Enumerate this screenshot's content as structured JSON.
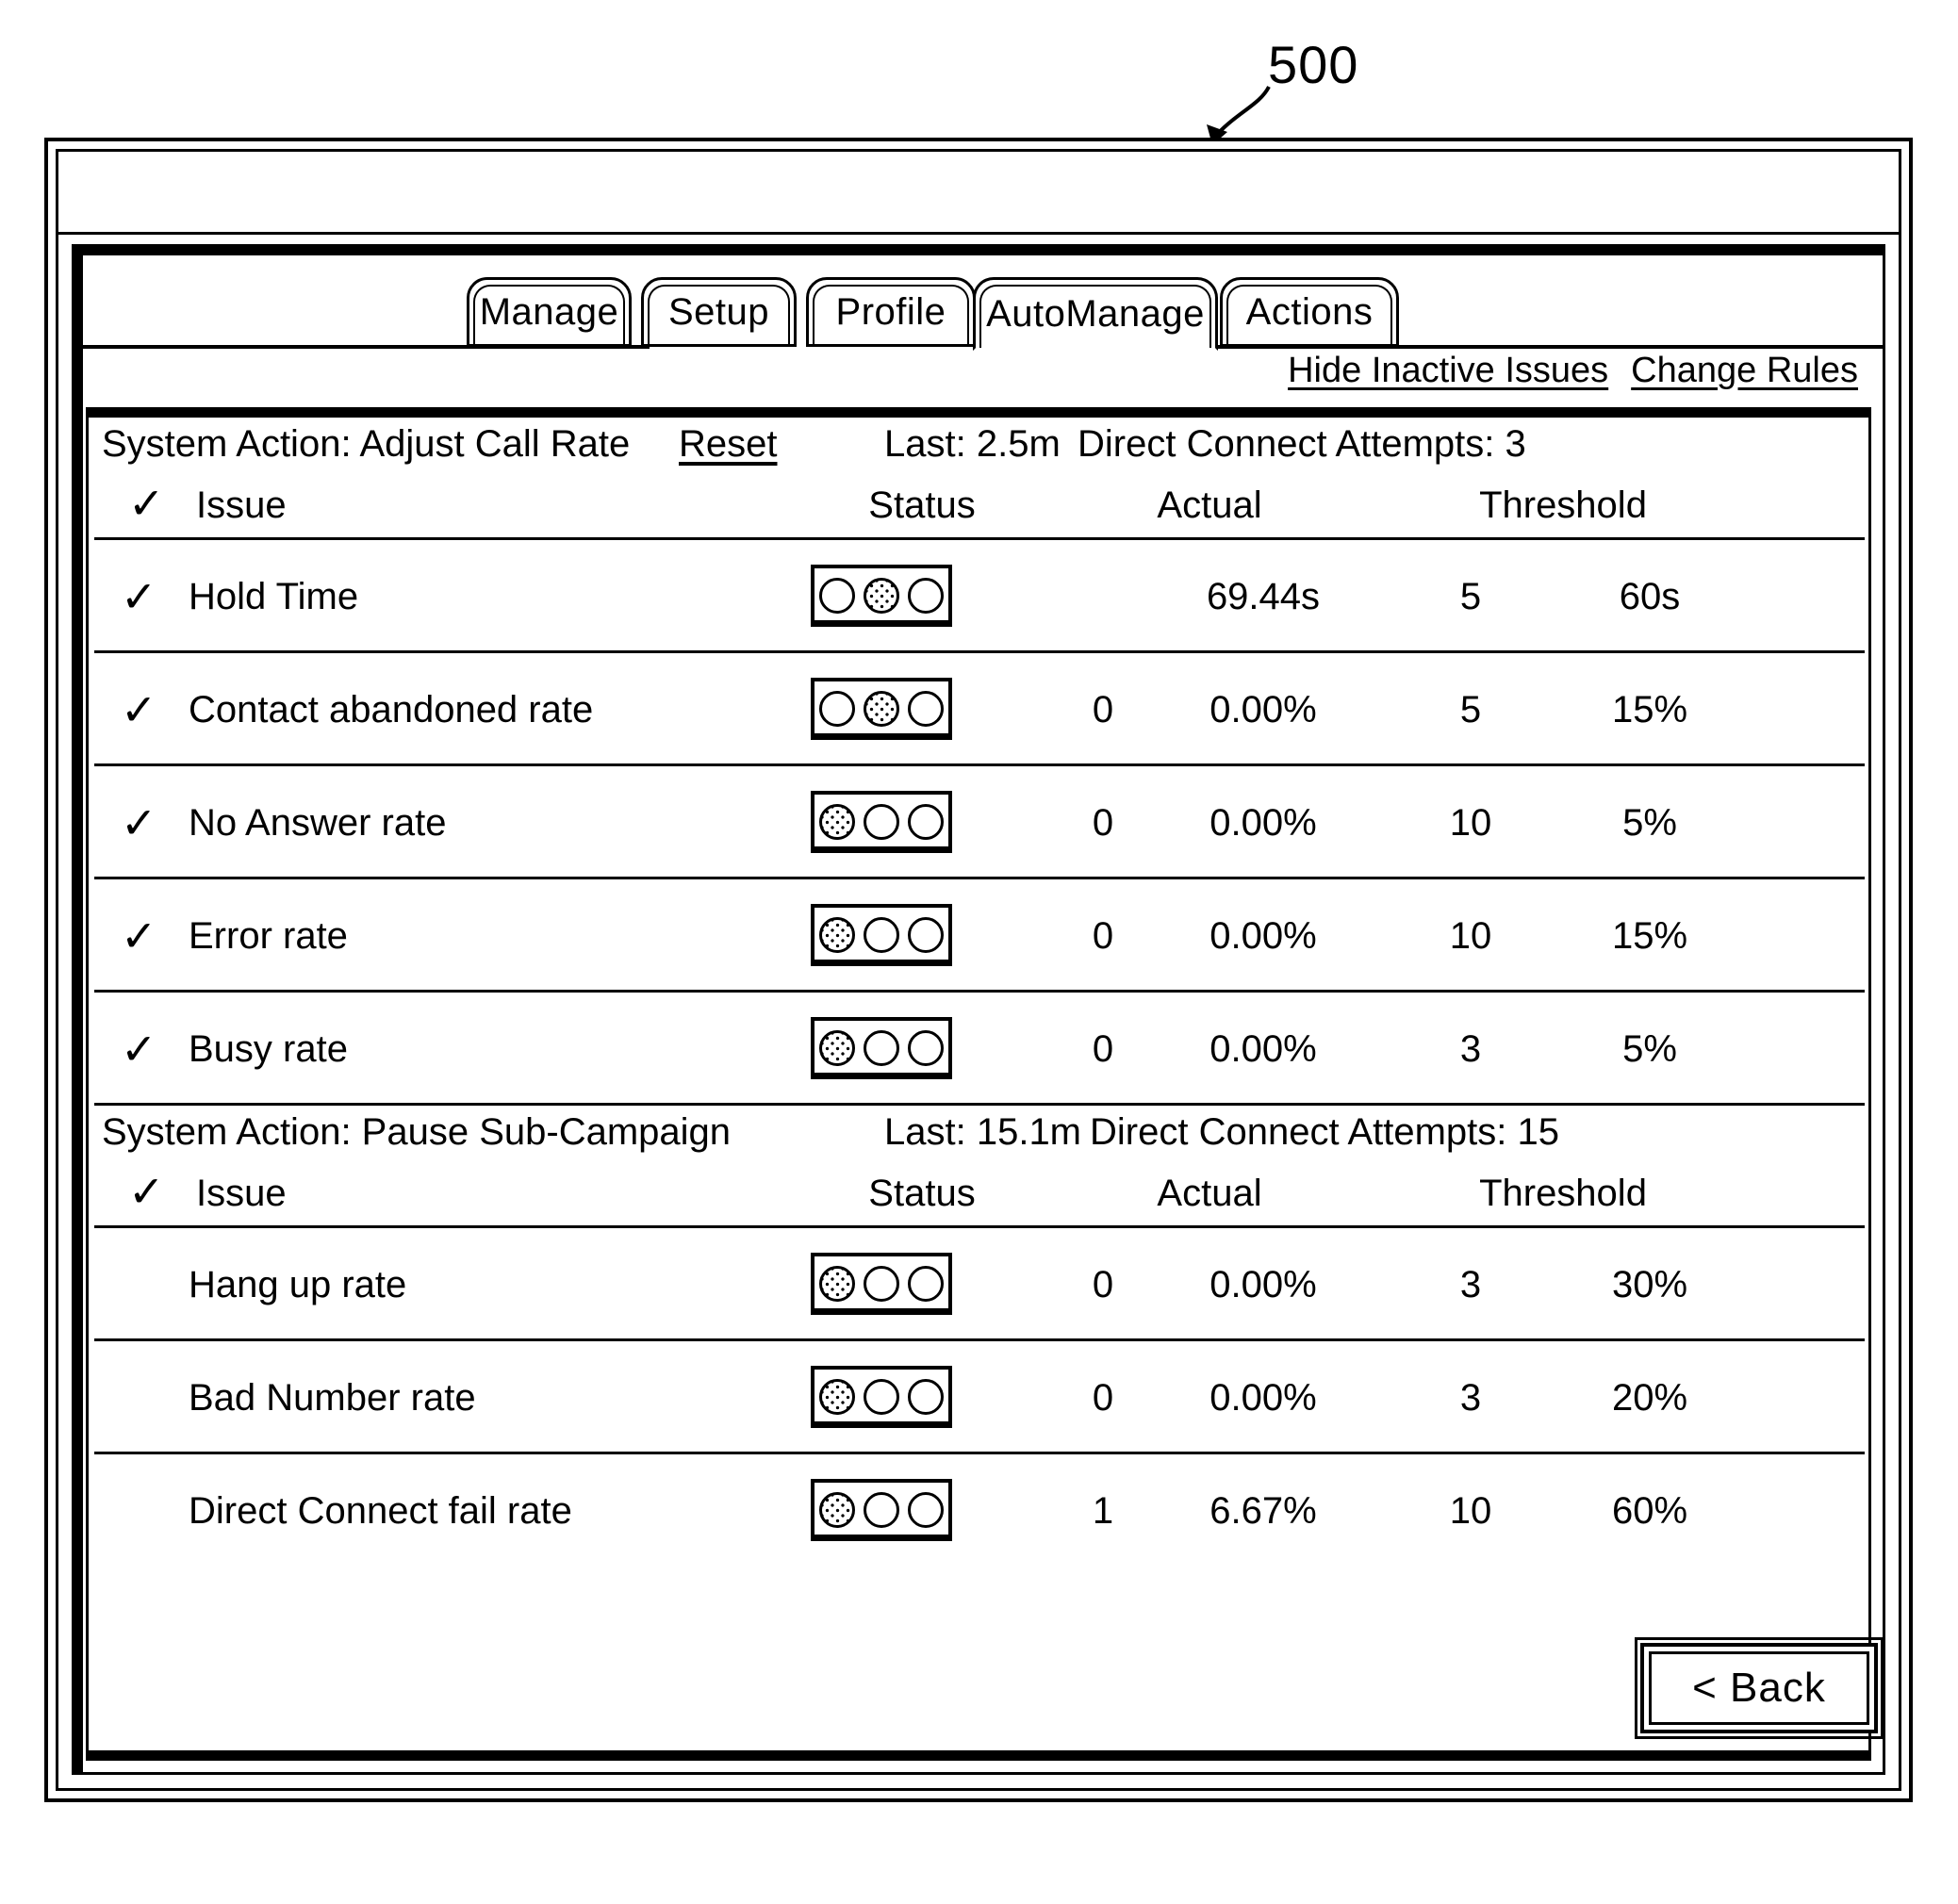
{
  "figure": {
    "ref_number": "500"
  },
  "tabs": [
    {
      "label": "Manage",
      "active": false
    },
    {
      "label": "Setup",
      "active": false
    },
    {
      "label": "Profile",
      "active": false
    },
    {
      "label": "AutoManage",
      "active": true
    },
    {
      "label": "Actions",
      "active": false
    }
  ],
  "links": [
    {
      "label": "Hide Inactive Issues"
    },
    {
      "label": "Change Rules"
    }
  ],
  "columns": {
    "issue": "Issue",
    "status": "Status",
    "actual": "Actual",
    "threshold": "Threshold"
  },
  "sections": [
    {
      "action_label": "System Action: Adjust Call Rate",
      "reset_label": "Reset",
      "last_label": "Last: 2.5m",
      "attempts_label": "Direct Connect Attempts: 3",
      "header_checked": true,
      "rows": [
        {
          "checked": true,
          "issue": "Hold Time",
          "light": 1,
          "count": "",
          "actual": "69.44s",
          "threshold_count": "5",
          "threshold_value": "60s"
        },
        {
          "checked": true,
          "issue": "Contact abandoned rate",
          "light": 1,
          "count": "0",
          "actual": "0.00%",
          "threshold_count": "5",
          "threshold_value": "15%"
        },
        {
          "checked": true,
          "issue": "No Answer rate",
          "light": 0,
          "count": "0",
          "actual": "0.00%",
          "threshold_count": "10",
          "threshold_value": "5%"
        },
        {
          "checked": true,
          "issue": "Error rate",
          "light": 0,
          "count": "0",
          "actual": "0.00%",
          "threshold_count": "10",
          "threshold_value": "15%"
        },
        {
          "checked": true,
          "issue": "Busy rate",
          "light": 0,
          "count": "0",
          "actual": "0.00%",
          "threshold_count": "3",
          "threshold_value": "5%"
        }
      ]
    },
    {
      "action_label": "System Action: Pause Sub-Campaign",
      "reset_label": "",
      "last_label": "Last: 15.1m",
      "attempts_label": "Direct Connect Attempts: 15",
      "header_checked": true,
      "rows": [
        {
          "checked": false,
          "issue": "Hang up rate",
          "light": 0,
          "count": "0",
          "actual": "0.00%",
          "threshold_count": "3",
          "threshold_value": "30%"
        },
        {
          "checked": false,
          "issue": "Bad Number rate",
          "light": 0,
          "count": "0",
          "actual": "0.00%",
          "threshold_count": "3",
          "threshold_value": "20%"
        },
        {
          "checked": false,
          "issue": "Direct Connect fail rate",
          "light": 0,
          "count": "1",
          "actual": "6.67%",
          "threshold_count": "10",
          "threshold_value": "60%"
        }
      ]
    }
  ],
  "footer": {
    "back_label": "< Back"
  },
  "glyphs": {
    "check": "✓"
  },
  "colors": {
    "ink": "#000000",
    "paper": "#ffffff"
  }
}
